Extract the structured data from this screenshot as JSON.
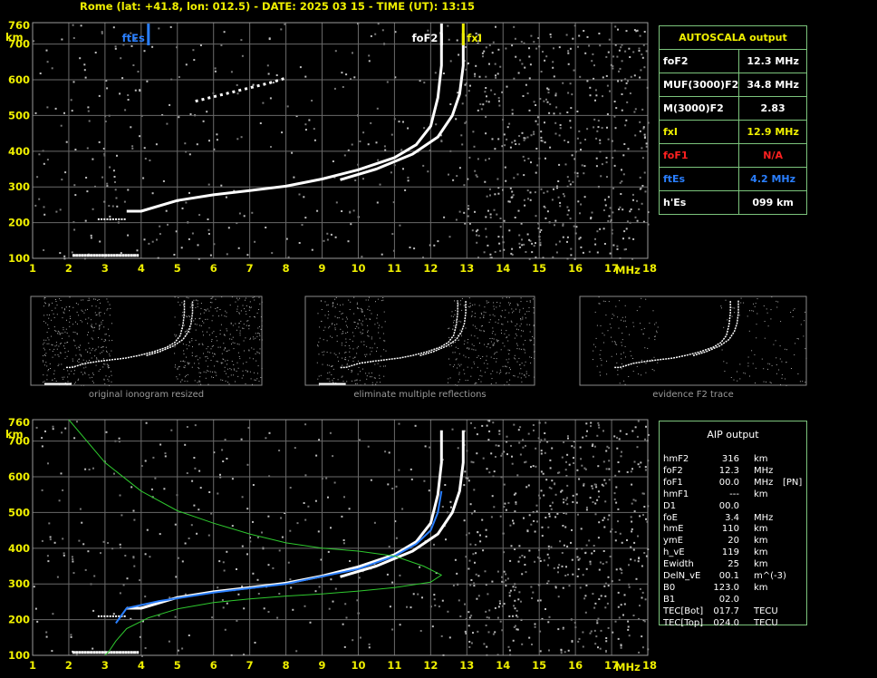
{
  "header": "Rome (lat: +41.8, lon: 012.5) - DATE: 2025 03 15 - TIME (UT): 13:15",
  "colors": {
    "yellow": "#f0f000",
    "blue": "#2a7fff",
    "red": "#ff2020",
    "green": "#2ec82e",
    "white": "#ffffff",
    "grid": "#6a6a6a"
  },
  "autoscala": {
    "title": "AUTOSCALA output",
    "rows": [
      {
        "label": "foF2",
        "value": "12.3 MHz",
        "color": "#ffffff"
      },
      {
        "label": "MUF(3000)F2",
        "value": "34.8 MHz",
        "color": "#ffffff"
      },
      {
        "label": "M(3000)F2",
        "value": "2.83",
        "color": "#ffffff"
      },
      {
        "label": "fxI",
        "value": "12.9 MHz",
        "color": "#f0f000"
      },
      {
        "label": "foF1",
        "value": "N/A",
        "color": "#ff2020"
      },
      {
        "label": "ftEs",
        "value": "4.2 MHz",
        "color": "#2a7fff"
      },
      {
        "label": "h'Es",
        "value": "099    km",
        "color": "#ffffff"
      }
    ]
  },
  "aip": {
    "title": "AIP output",
    "rows": [
      [
        "hmF2",
        "316",
        "km",
        ""
      ],
      [
        "foF2",
        "12.3",
        "MHz",
        ""
      ],
      [
        "foF1",
        "00.0",
        "MHz",
        "[PN]"
      ],
      [
        "hmF1",
        "---",
        "km",
        ""
      ],
      [
        "D1",
        "00.0",
        "",
        ""
      ],
      [
        "foE",
        "3.4",
        "MHz",
        ""
      ],
      [
        "hmE",
        "110",
        "km",
        ""
      ],
      [
        "ymE",
        "20",
        "km",
        ""
      ],
      [
        "h_vE",
        "119",
        "km",
        ""
      ],
      [
        "Ewidth",
        "25",
        "km",
        ""
      ],
      [
        "DelN_vE",
        "00.1",
        "m^(-3)",
        ""
      ],
      [
        "B0",
        "123.0",
        "km",
        ""
      ],
      [
        "B1",
        "02.0",
        "",
        ""
      ],
      [
        "TEC[Bot]",
        "017.7",
        "TECU",
        ""
      ],
      [
        "TEC[Top]",
        "024.0",
        "TECU",
        ""
      ]
    ]
  },
  "captions": [
    "original ionogram resized",
    "eliminate multiple reflections",
    "evidence F2 trace"
  ],
  "chart_data": [
    {
      "type": "scatter",
      "title": "",
      "xlabel": "MHz",
      "ylabel": "km",
      "xlim": [
        1,
        18
      ],
      "ylim": [
        100,
        760
      ],
      "xticks": [
        "1",
        "2",
        "3",
        "4",
        "5",
        "6",
        "7",
        "8",
        "9",
        "10",
        "11",
        "12",
        "13",
        "14",
        "15",
        "16",
        "17",
        "18"
      ],
      "yticks": [
        "100",
        "200",
        "300",
        "400",
        "500",
        "600",
        "700",
        "760"
      ],
      "markers": [
        {
          "label": "ftEs",
          "x": 4.2,
          "color": "#2a7fff"
        },
        {
          "label": "foF2",
          "x": 12.3,
          "color": "#ffffff"
        },
        {
          "label": "fxI",
          "x": 12.9,
          "color": "#f0f000"
        }
      ],
      "series": [
        {
          "values": [
            [
              3.6,
              232
            ],
            [
              4.0,
              232
            ],
            [
              5.0,
              262
            ],
            [
              6.0,
              278
            ],
            [
              7.0,
              290
            ],
            [
              8.0,
              302
            ],
            [
              9.0,
              322
            ],
            [
              10.0,
              348
            ],
            [
              11.0,
              382
            ],
            [
              11.6,
              418
            ],
            [
              12.0,
              470
            ],
            [
              12.2,
              550
            ],
            [
              12.3,
              640
            ],
            [
              12.3,
              730
            ]
          ],
          "color": "#ffffff"
        },
        {
          "values": [
            [
              9.5,
              320
            ],
            [
              10.5,
              350
            ],
            [
              11.5,
              392
            ],
            [
              12.2,
              440
            ],
            [
              12.6,
              500
            ],
            [
              12.8,
              560
            ],
            [
              12.9,
              640
            ],
            [
              12.9,
              730
            ]
          ],
          "color": "#ffffff"
        },
        {
          "values": [
            [
              5.5,
              540
            ],
            [
              6.5,
              565
            ],
            [
              7.5,
              590
            ],
            [
              8.0,
              605
            ]
          ],
          "color": "#ffffff"
        }
      ]
    },
    {
      "type": "line",
      "title": "",
      "xlabel": "MHz",
      "ylabel": "km",
      "xlim": [
        1,
        18
      ],
      "ylim": [
        100,
        760
      ],
      "xticks": [
        "1",
        "2",
        "3",
        "4",
        "5",
        "6",
        "7",
        "8",
        "9",
        "10",
        "11",
        "12",
        "13",
        "14",
        "15",
        "16",
        "17",
        "18"
      ],
      "yticks": [
        "100",
        "200",
        "300",
        "400",
        "500",
        "600",
        "700",
        "760"
      ],
      "series": [
        {
          "values": [
            [
              3.6,
              232
            ],
            [
              4.0,
              232
            ],
            [
              5.0,
              262
            ],
            [
              6.0,
              278
            ],
            [
              7.0,
              290
            ],
            [
              8.0,
              302
            ],
            [
              9.0,
              322
            ],
            [
              10.0,
              348
            ],
            [
              11.0,
              382
            ],
            [
              11.6,
              418
            ],
            [
              12.0,
              470
            ],
            [
              12.2,
              550
            ],
            [
              12.3,
              640
            ],
            [
              12.3,
              730
            ]
          ],
          "color": "#ffffff"
        },
        {
          "values": [
            [
              9.5,
              320
            ],
            [
              10.5,
              350
            ],
            [
              11.5,
              392
            ],
            [
              12.2,
              440
            ],
            [
              12.6,
              500
            ],
            [
              12.8,
              560
            ],
            [
              12.9,
              640
            ],
            [
              12.9,
              730
            ]
          ],
          "color": "#ffffff"
        },
        {
          "values": [
            [
              3.3,
              190
            ],
            [
              3.6,
              232
            ],
            [
              4.5,
              252
            ],
            [
              6,
              276
            ],
            [
              8,
              300
            ],
            [
              10,
              342
            ],
            [
              11,
              378
            ],
            [
              11.6,
              412
            ],
            [
              12.0,
              450
            ],
            [
              12.2,
              500
            ],
            [
              12.3,
              560
            ]
          ],
          "color": "#2a7fff"
        },
        {
          "values": [
            [
              2.0,
              760
            ],
            [
              3.0,
              640
            ],
            [
              4.0,
              560
            ],
            [
              5.0,
              505
            ],
            [
              6.0,
              470
            ],
            [
              7.0,
              440
            ],
            [
              8.0,
              415
            ],
            [
              9.0,
              400
            ],
            [
              10.0,
              392
            ],
            [
              11.0,
              378
            ],
            [
              11.8,
              350
            ],
            [
              12.3,
              325
            ],
            [
              12.0,
              305
            ],
            [
              11.0,
              290
            ],
            [
              10.0,
              280
            ],
            [
              9.0,
              272
            ],
            [
              8.0,
              266
            ],
            [
              7.0,
              258
            ],
            [
              6.0,
              248
            ],
            [
              5.0,
              230
            ],
            [
              4.2,
              205
            ],
            [
              3.6,
              175
            ],
            [
              3.3,
              140
            ],
            [
              3.1,
              110
            ],
            [
              3.0,
              100
            ]
          ],
          "color": "#2ec82e"
        }
      ]
    }
  ]
}
